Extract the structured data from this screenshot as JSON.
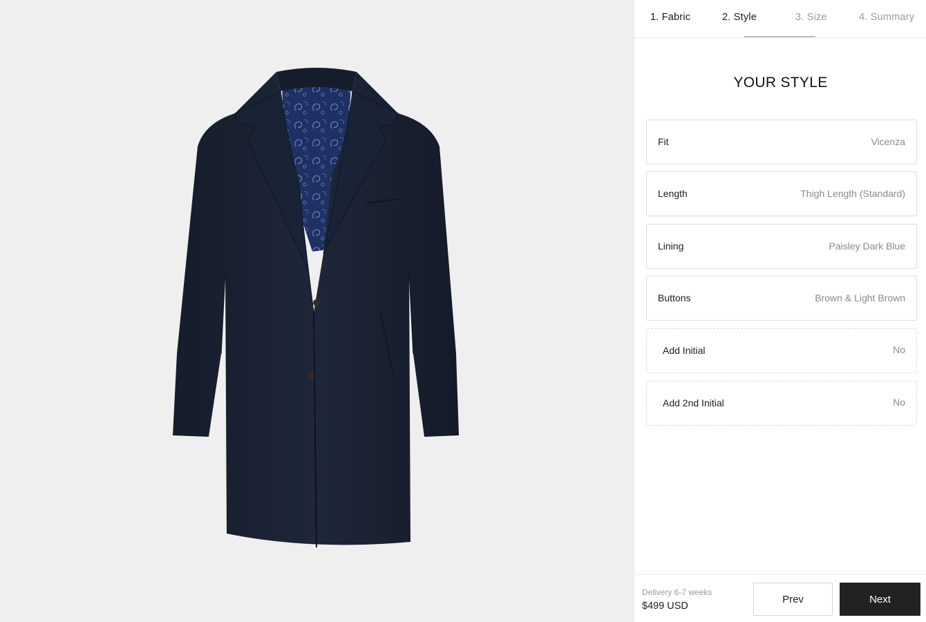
{
  "steps": [
    {
      "label": "1. Fabric",
      "state": "done"
    },
    {
      "label": "2. Style",
      "state": "active"
    },
    {
      "label": "3. Size",
      "state": "todo"
    },
    {
      "label": "4. Summary",
      "state": "todo"
    }
  ],
  "section_title": "YOUR STYLE",
  "options": [
    {
      "label": "Fit",
      "value": "Vicenza"
    },
    {
      "label": "Length",
      "value": "Thigh Length (Standard)"
    },
    {
      "label": "Lining",
      "value": "Paisley Dark Blue"
    },
    {
      "label": "Buttons",
      "value": "Brown & Light Brown"
    },
    {
      "label": "Add Initial",
      "value": "No"
    },
    {
      "label": "Add 2nd Initial",
      "value": "No"
    }
  ],
  "footer": {
    "delivery": "Delivery 6-7 weeks",
    "price": "$499 USD",
    "prev_label": "Prev",
    "next_label": "Next"
  },
  "colors": {
    "coat": "#1b2436",
    "lining": "#22356a",
    "next_button": "#222222"
  }
}
